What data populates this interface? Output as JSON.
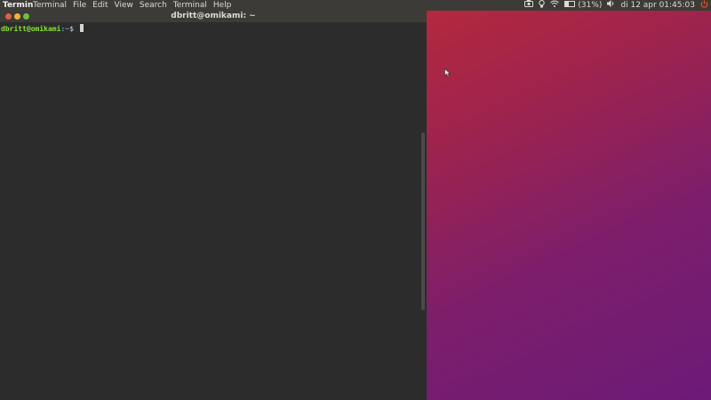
{
  "top_panel": {
    "app_title": "Termin",
    "menu": [
      "Terminal",
      "File",
      "Edit",
      "View",
      "Search",
      "Terminal",
      "Help"
    ],
    "indicators": {
      "icons": [
        "camera-icon",
        "lightbulb-icon",
        "wifi-icon",
        "battery-icon",
        "volume-icon",
        "power-icon"
      ],
      "battery_text": "(31%)",
      "battery_level": 0.31,
      "datetime": "di 12 apr 01:45:03"
    }
  },
  "window": {
    "title": "dbritt@omikami: ~"
  },
  "terminal": {
    "prompt_user": "dbritt@omikami",
    "prompt_path": ":~",
    "prompt_symbol": "$ ",
    "scroll_position": 0.55
  },
  "colors": {
    "panel": "#3c3b37",
    "terminal_bg": "#2c2c2c",
    "prompt_user": "#8ae234",
    "prompt_path": "#729fcf",
    "close": "#e0603c",
    "minimize": "#f1b23b",
    "maximize": "#69c041",
    "desktop_top": "#b4283d",
    "desktop_bottom": "#6c1a78",
    "power": "#e95420"
  }
}
